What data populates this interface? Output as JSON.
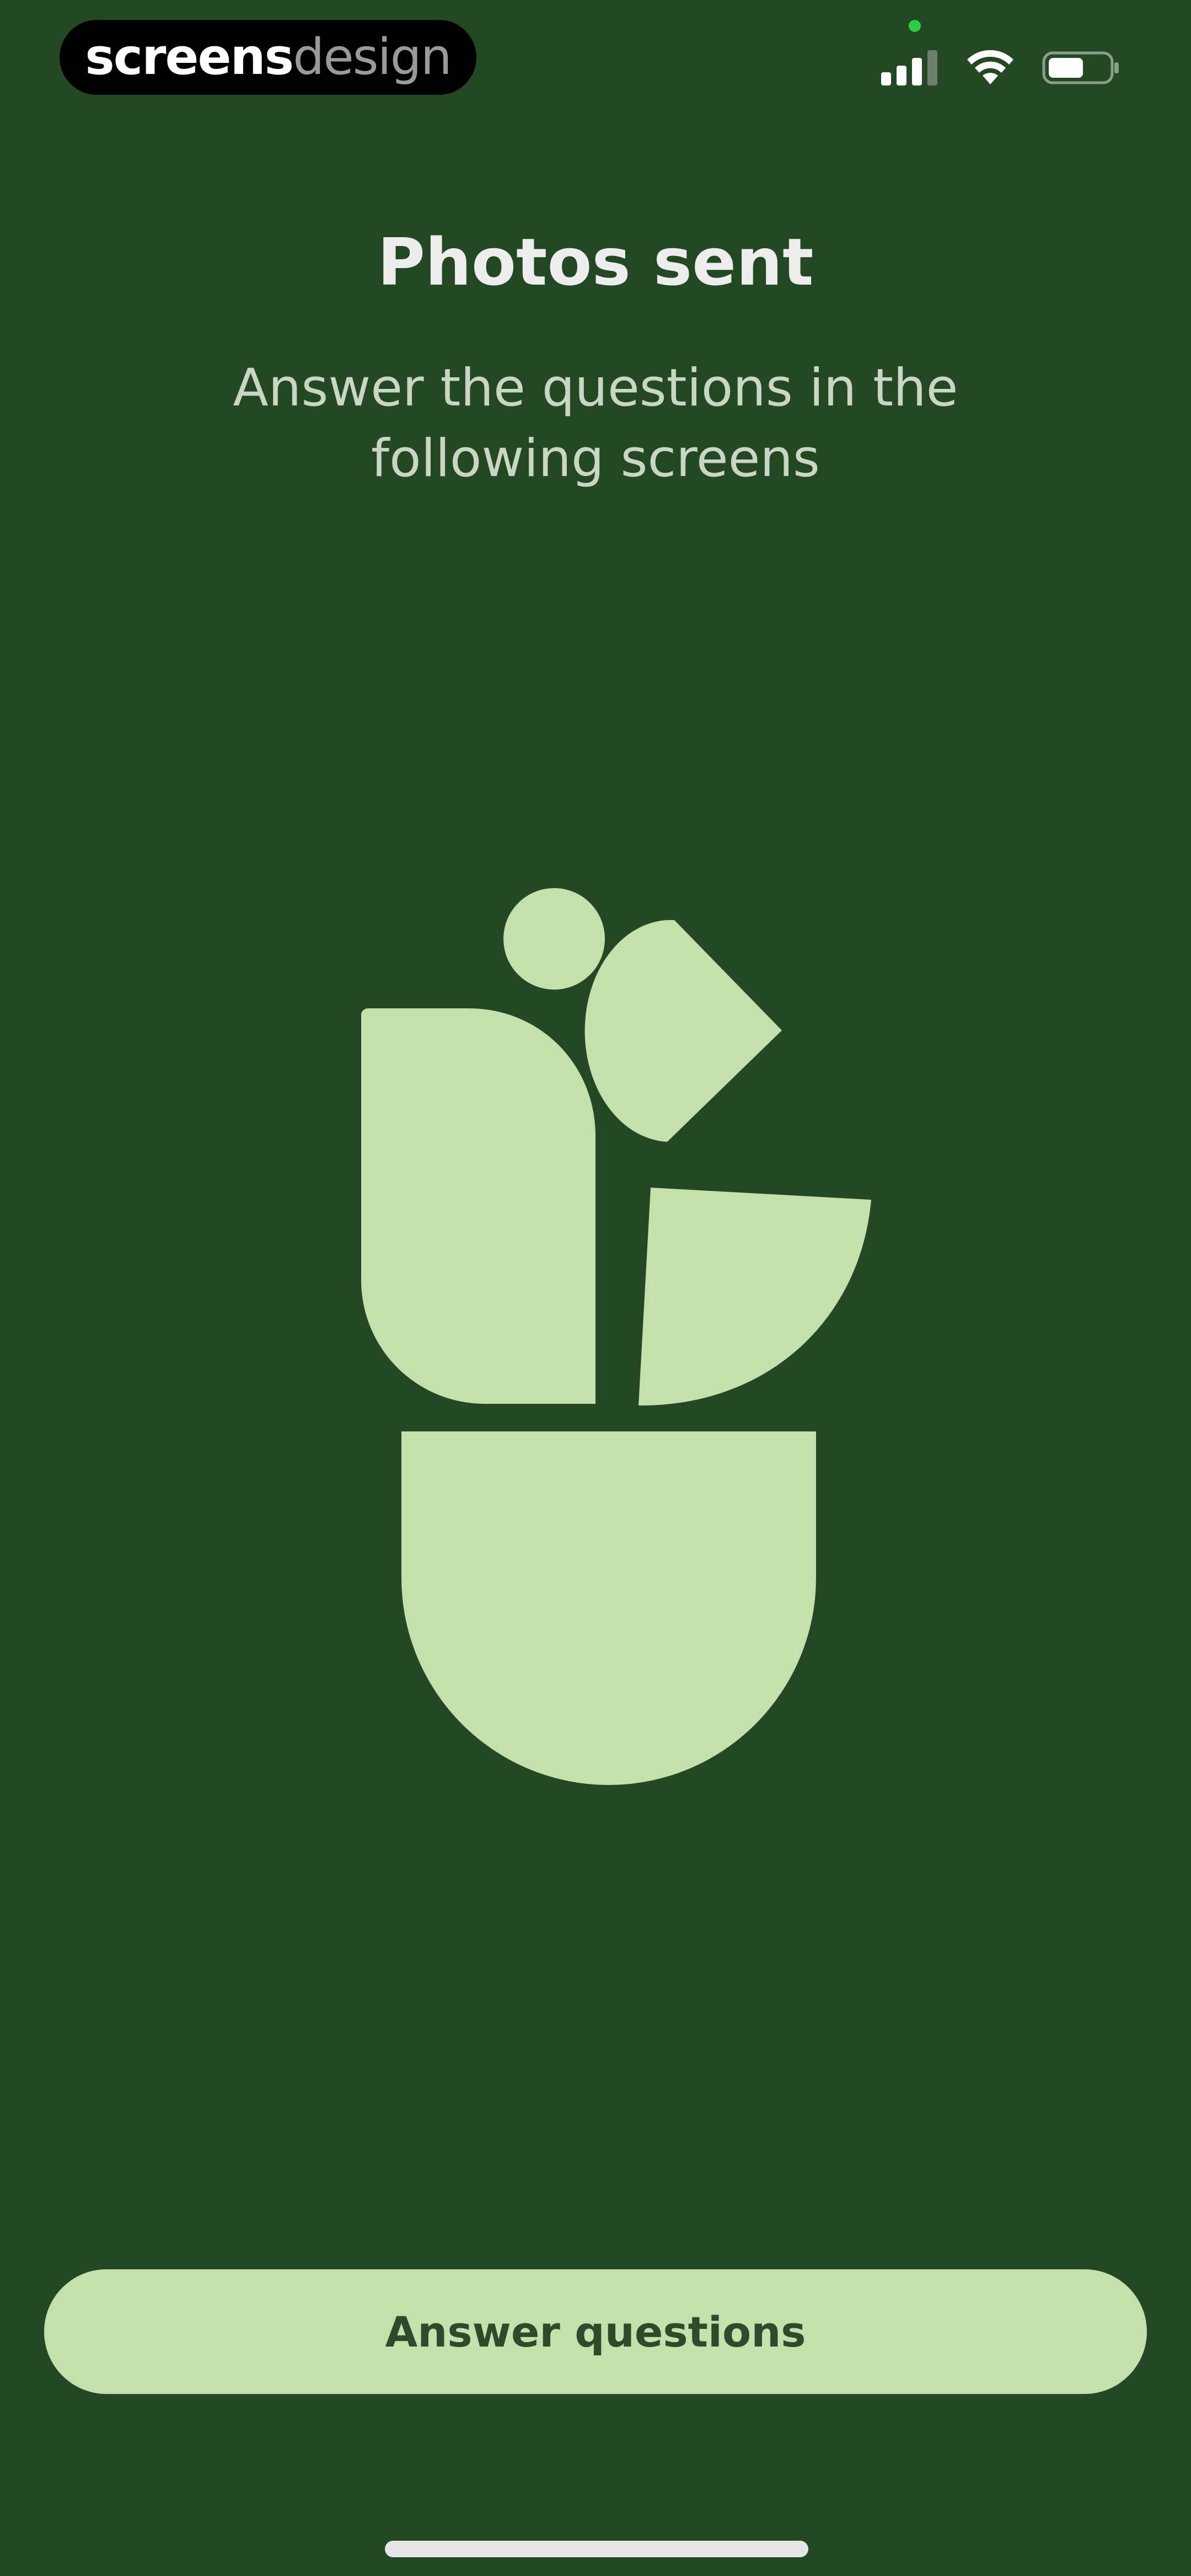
{
  "status_bar": {
    "brand_strong": "screens",
    "brand_light": "design",
    "icons": [
      "cellular-signal-icon",
      "wifi-icon",
      "battery-icon"
    ]
  },
  "header": {
    "title": "Photos sent",
    "subtitle": "Answer the questions in the following screens"
  },
  "illustration": {
    "name": "plant-in-pot-illustration"
  },
  "actions": {
    "primary_label": "Answer questions"
  },
  "colors": {
    "background": "#234823",
    "accent": "#c5dfad",
    "button_text": "#2f4a2a"
  }
}
